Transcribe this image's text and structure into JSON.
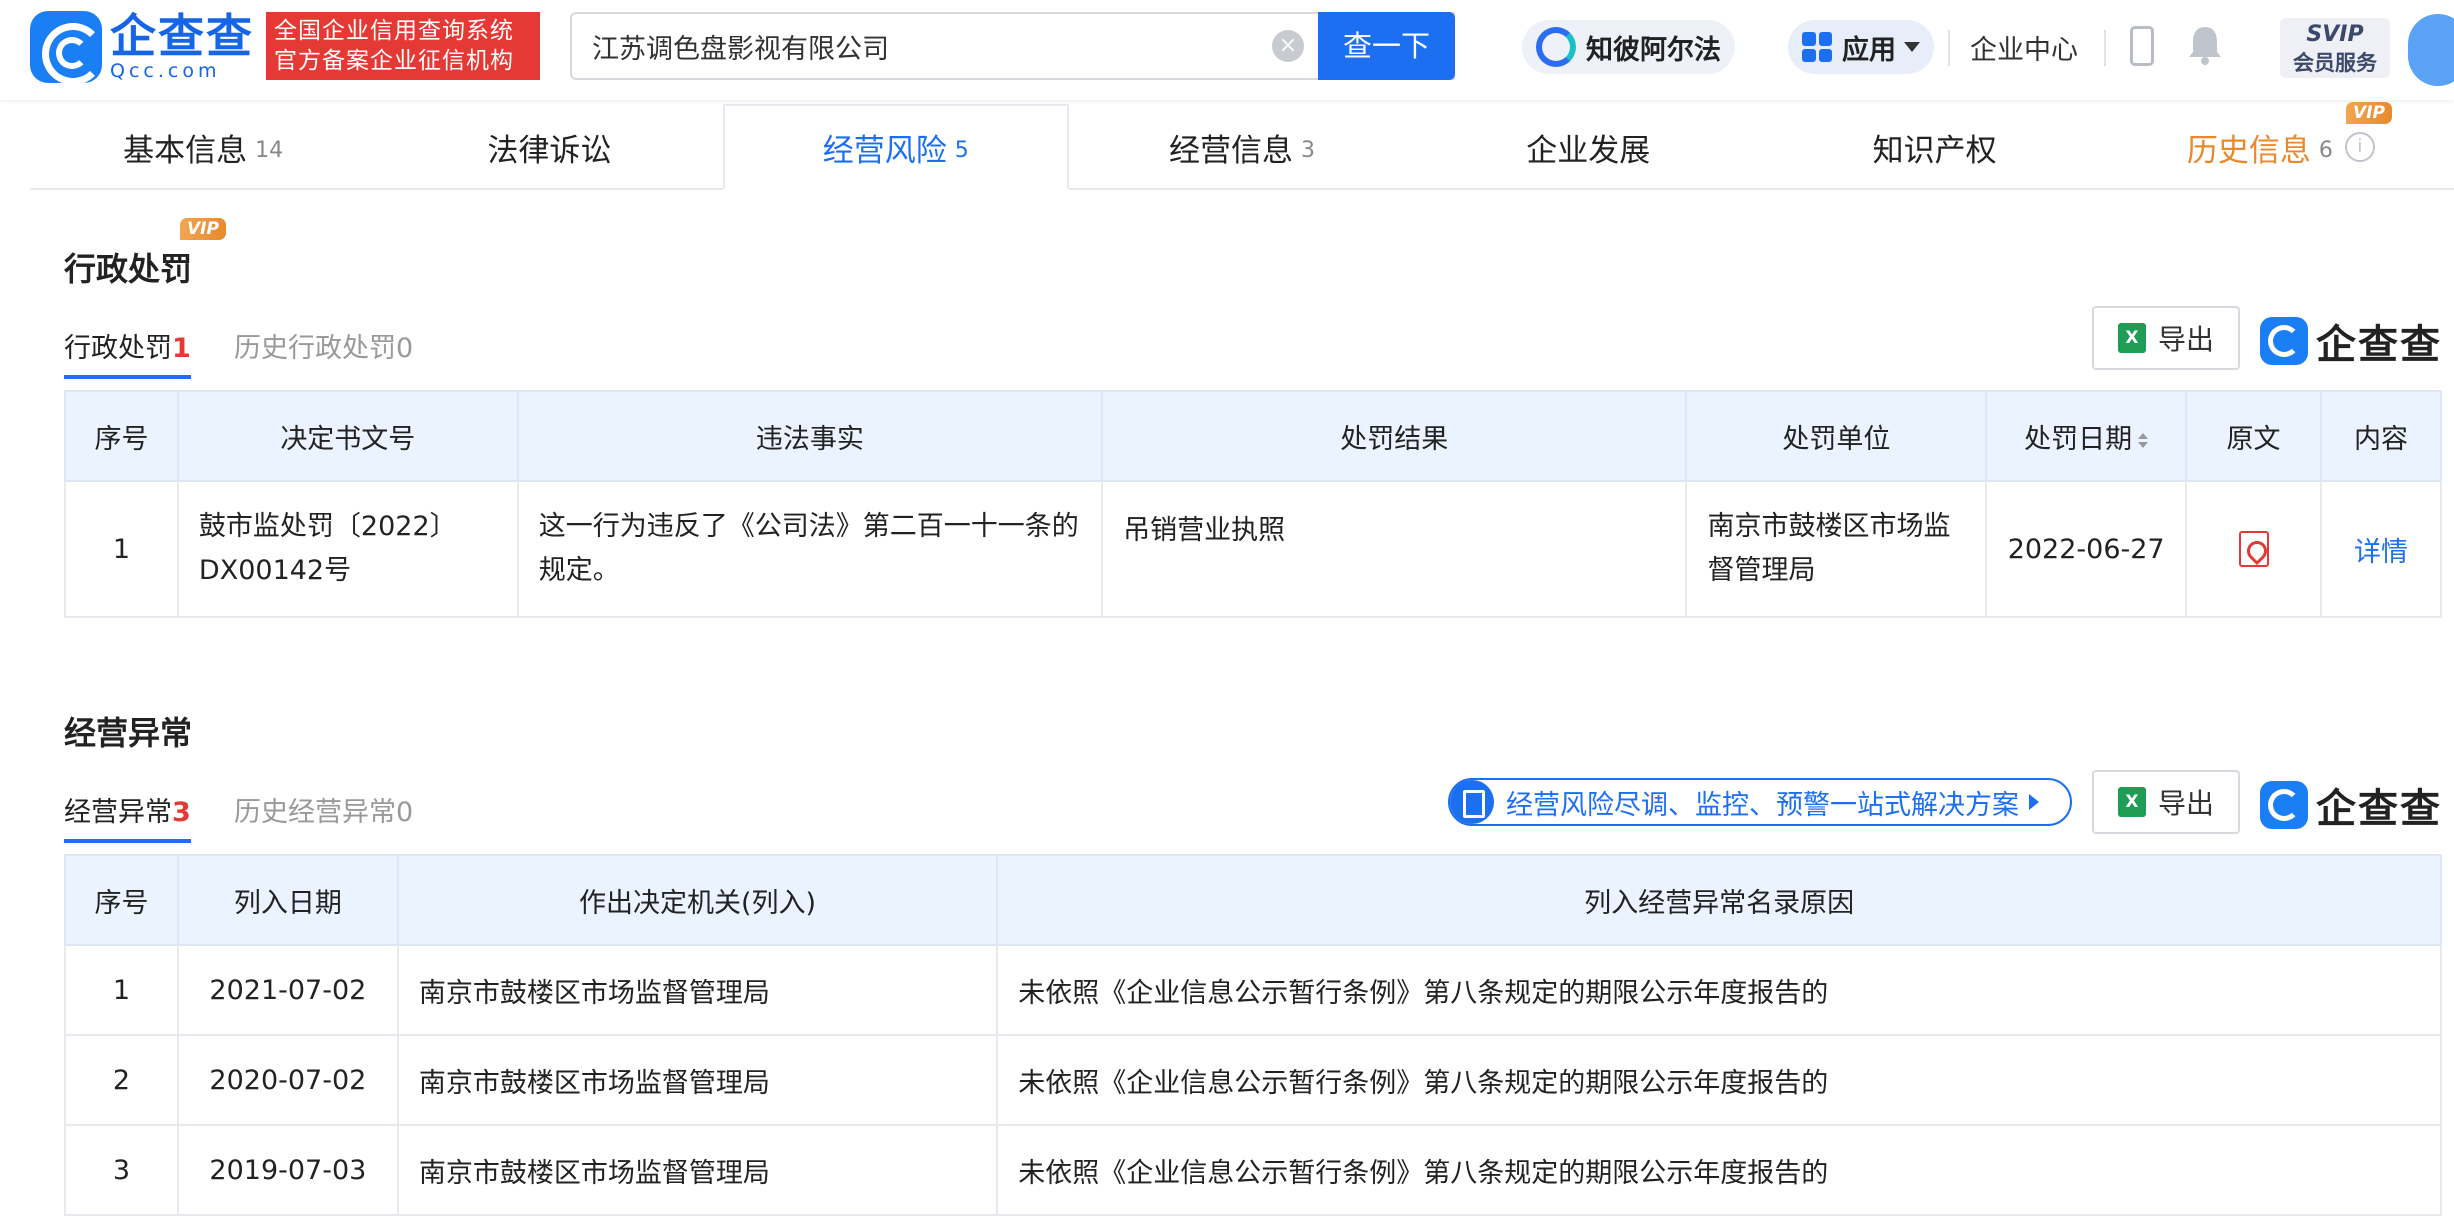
{
  "header": {
    "logo_cn": "企查查",
    "logo_en": "Qcc.com",
    "tagline_line1": "全国企业信用查询系统",
    "tagline_line2": "官方备案企业征信机构",
    "search_value": "江苏调色盘影视有限公司",
    "search_button": "查一下",
    "ai_label": "知彼阿尔法",
    "apps_label": "应用",
    "enterprise_center": "企业中心",
    "svip_top": "SVIP",
    "svip_bottom": "会员服务"
  },
  "tabs": [
    {
      "label": "基本信息",
      "count": "14"
    },
    {
      "label": "法律诉讼",
      "count": ""
    },
    {
      "label": "经营风险",
      "count": "5"
    },
    {
      "label": "经营信息",
      "count": "3"
    },
    {
      "label": "企业发展",
      "count": ""
    },
    {
      "label": "知识产权",
      "count": ""
    },
    {
      "label": "历史信息",
      "count": "6"
    }
  ],
  "vip_badge": "VIP",
  "admin_penalty": {
    "title": "行政处罚",
    "subtab_active": "行政处罚",
    "subtab_active_count": "1",
    "subtab_history": "历史行政处罚",
    "subtab_history_count": "0",
    "export_label": "导出",
    "brand": "企查查",
    "columns": [
      "序号",
      "决定书文号",
      "违法事实",
      "处罚结果",
      "处罚单位",
      "处罚日期",
      "原文",
      "内容"
    ],
    "rows": [
      {
        "index": "1",
        "doc_no": "鼓市监处罚〔2022〕DX00142号",
        "fact": "这一行为违反了《公司法》第二百一十一条的规定。",
        "result": "吊销营业执照",
        "authority": "南京市鼓楼区市场监督管理局",
        "date": "2022-06-27",
        "detail": "详情"
      }
    ]
  },
  "abnormal": {
    "title": "经营异常",
    "subtab_active": "经营异常",
    "subtab_active_count": "3",
    "subtab_history": "历史经营异常",
    "subtab_history_count": "0",
    "promo": "经营风险尽调、监控、预警一站式解决方案",
    "export_label": "导出",
    "brand": "企查查",
    "columns": [
      "序号",
      "列入日期",
      "作出决定机关(列入)",
      "列入经营异常名录原因"
    ],
    "rows": [
      {
        "index": "1",
        "date": "2021-07-02",
        "authority": "南京市鼓楼区市场监督管理局",
        "reason": "未依照《企业信息公示暂行条例》第八条规定的期限公示年度报告的"
      },
      {
        "index": "2",
        "date": "2020-07-02",
        "authority": "南京市鼓楼区市场监督管理局",
        "reason": "未依照《企业信息公示暂行条例》第八条规定的期限公示年度报告的"
      },
      {
        "index": "3",
        "date": "2019-07-03",
        "authority": "南京市鼓楼区市场监督管理局",
        "reason": "未依照《企业信息公示暂行条例》第八条规定的期限公示年度报告的"
      }
    ]
  }
}
